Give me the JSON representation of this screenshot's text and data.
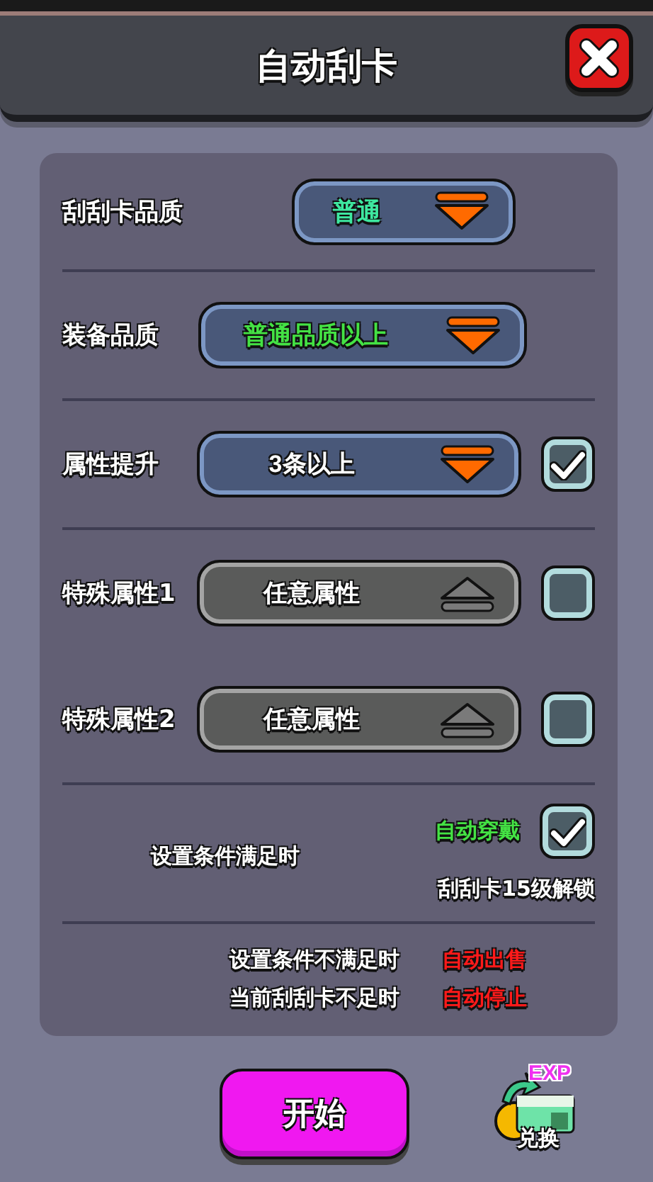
{
  "title": "自动刮卡",
  "filters": [
    {
      "kind": "dropdown",
      "label": "刮刮卡品质",
      "value": "普通",
      "color": "#3ee8a0",
      "disabled": false
    },
    {
      "kind": "dropdown",
      "label": "装备品质",
      "value": "普通品质以上",
      "color": "#44e244",
      "disabled": false
    },
    {
      "kind": "dropdown-check",
      "label": "属性提升",
      "value": "3条以上",
      "color": "#ffffff",
      "disabled": false,
      "checked": true
    },
    {
      "kind": "dropdown-check",
      "label": "特殊属性1",
      "value": "任意属性",
      "color": "#ffffff",
      "disabled": true,
      "checked": false
    },
    {
      "kind": "dropdown-check",
      "label": "特殊属性2",
      "value": "任意属性",
      "color": "#ffffff",
      "disabled": true,
      "checked": false
    }
  ],
  "auto_equip": {
    "condition": "设置条件满足时",
    "action": "自动穿戴",
    "checked": true,
    "unlock_note": "刮刮卡15级解锁"
  },
  "rules": [
    {
      "condition": "设置条件不满足时",
      "action": "自动出售"
    },
    {
      "condition": "当前刮刮卡不足时",
      "action": "自动停止"
    }
  ],
  "start_button": "开始",
  "exchange": {
    "badge": "EXP",
    "label": "兑换"
  }
}
